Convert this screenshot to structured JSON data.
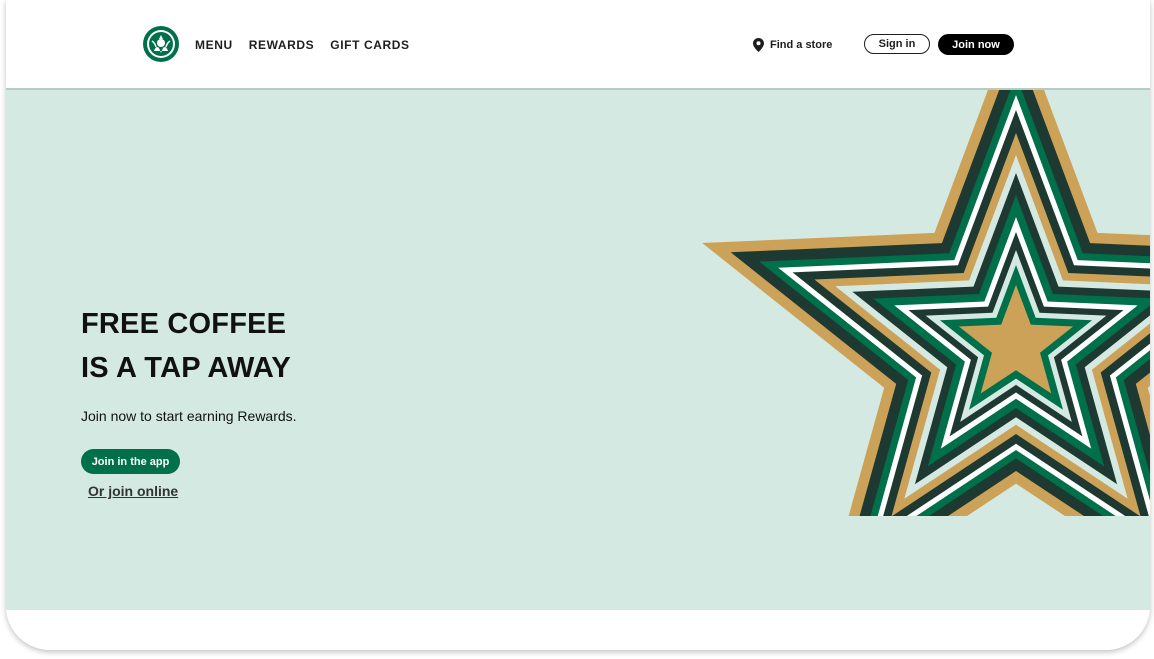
{
  "header": {
    "logo_name": "starbucks-siren-logo",
    "nav": [
      "MENU",
      "REWARDS",
      "GIFT CARDS"
    ],
    "find_store": "Find a store",
    "sign_in": "Sign in",
    "join_now": "Join now"
  },
  "hero": {
    "title_line1": "FREE COFFEE",
    "title_line2": "IS A TAP AWAY",
    "subtitle": "Join now to start earning Rewards.",
    "app_button": "Join in the app",
    "online_link": "Or join online"
  },
  "colors": {
    "brand_green": "#00704a",
    "hero_bg": "#d4e9e2",
    "gold": "#cba258",
    "dark_green": "#1e3932",
    "star_green": "#00704a"
  }
}
